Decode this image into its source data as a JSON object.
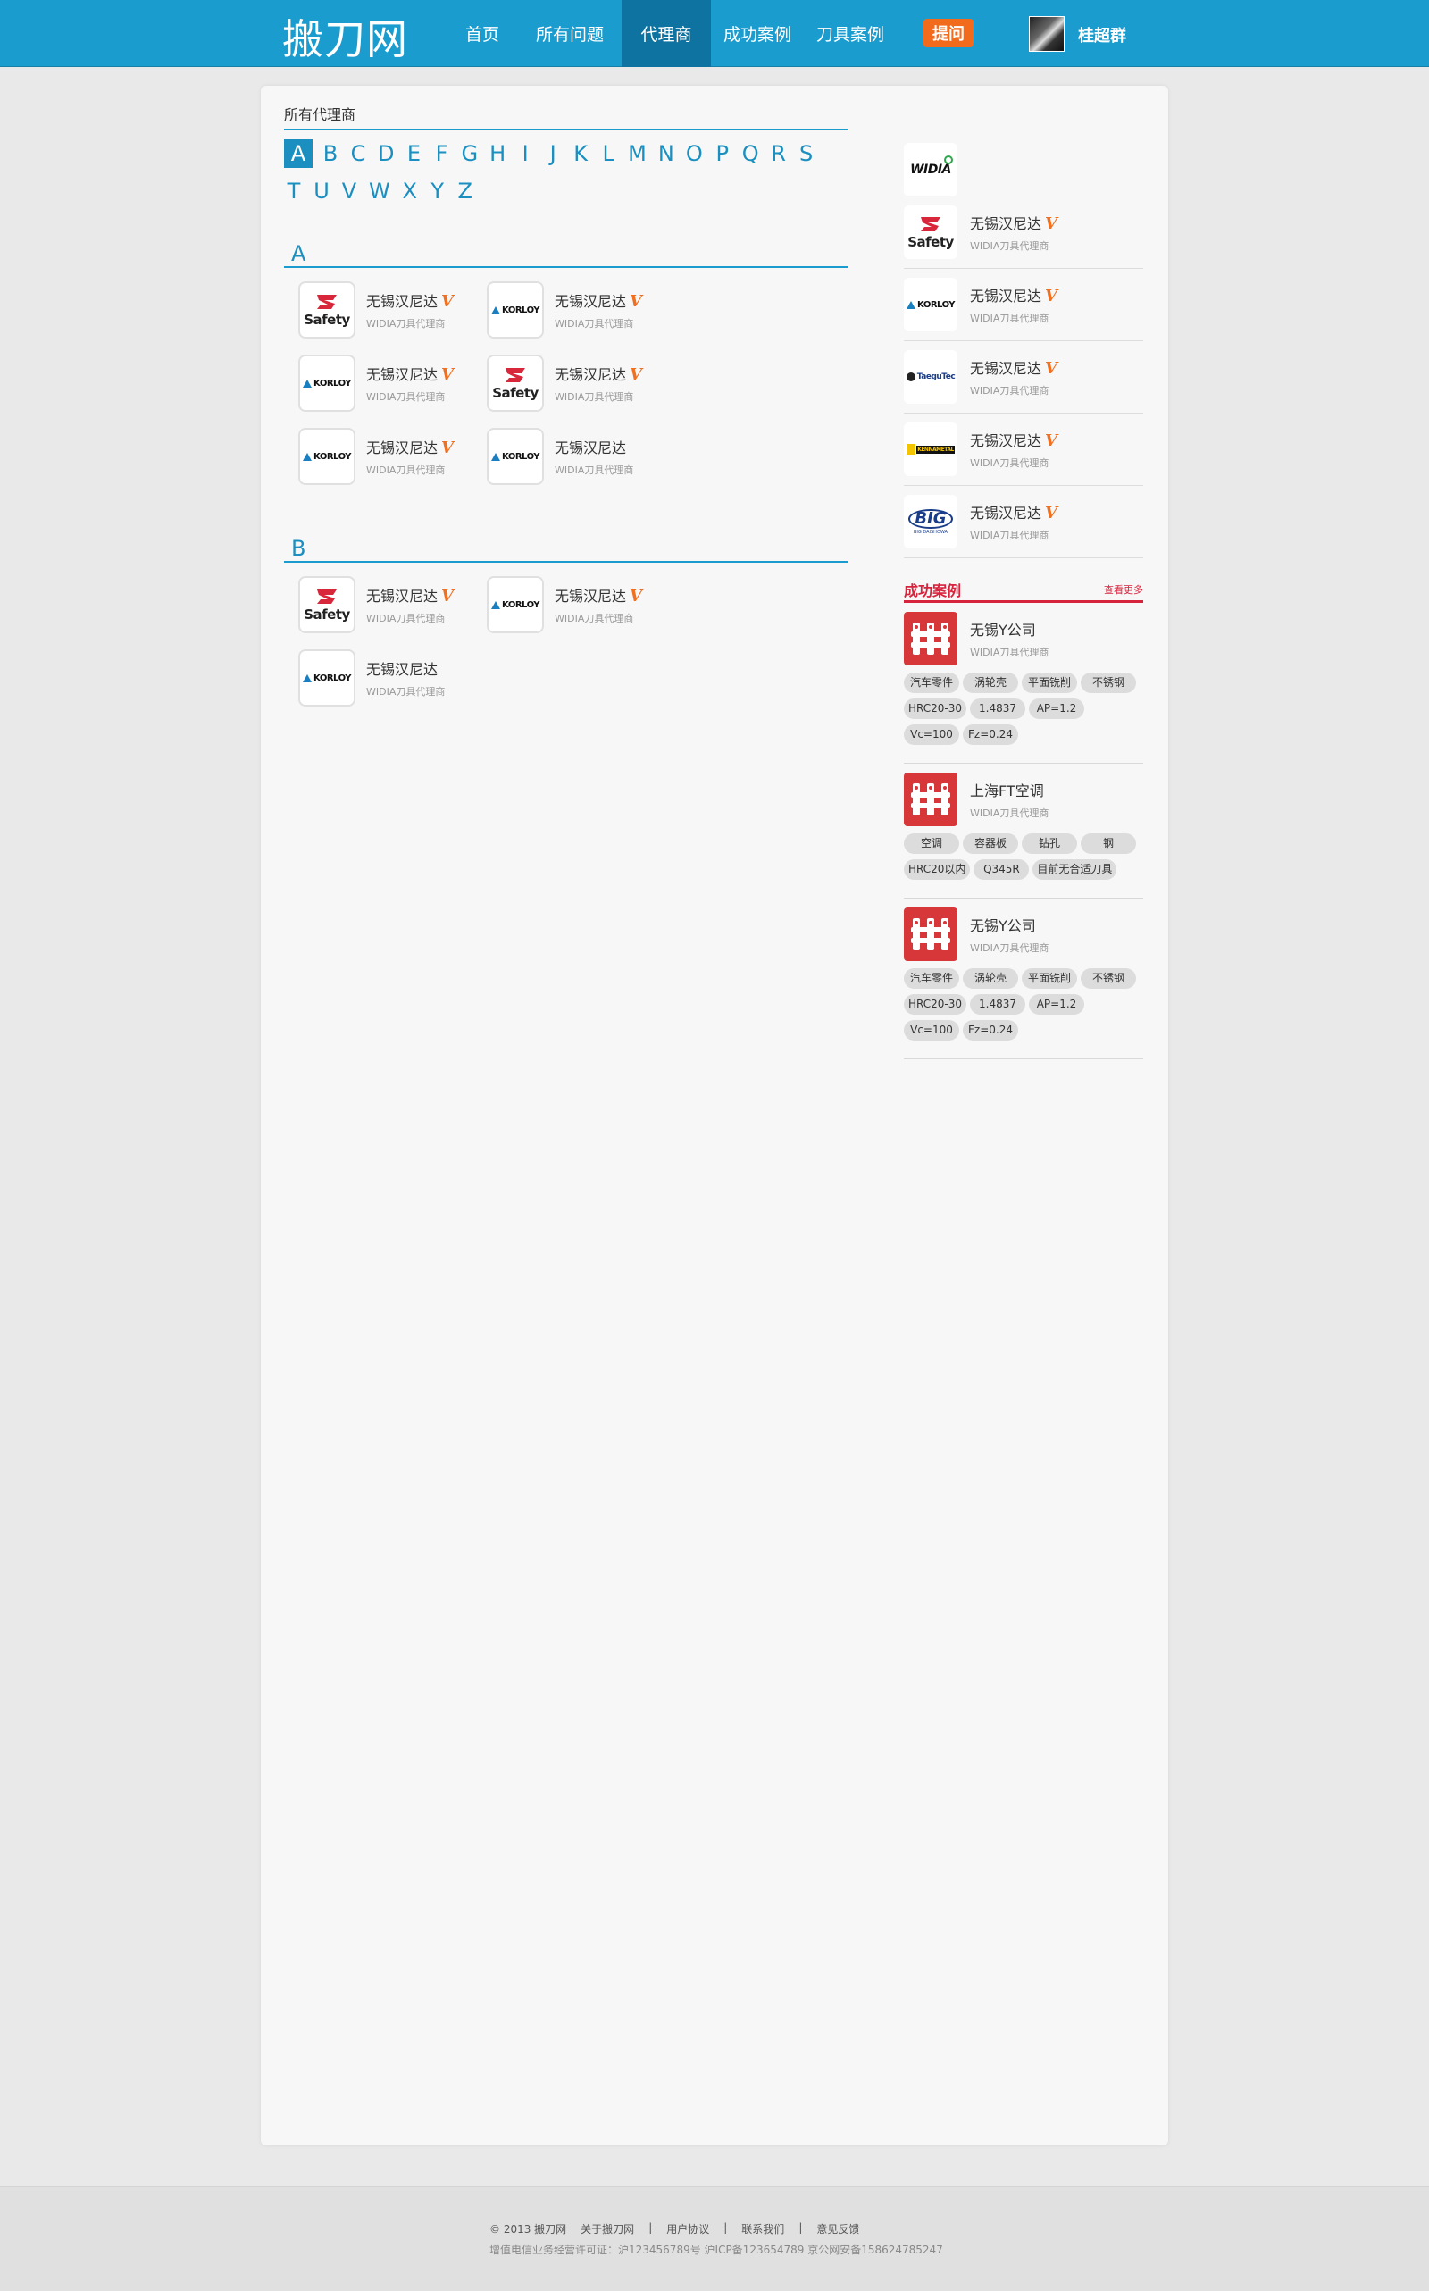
{
  "header": {
    "logo": "搬刀网",
    "nav": [
      {
        "label": "首页",
        "active": false
      },
      {
        "label": "所有问题",
        "active": false
      },
      {
        "label": "代理商",
        "active": true
      },
      {
        "label": "成功案例",
        "active": false
      },
      {
        "label": "刀具案例",
        "active": false
      }
    ],
    "ask_button": "提问",
    "user_name": "桂超群"
  },
  "directory": {
    "title": "所有代理商",
    "letters": [
      "A",
      "B",
      "C",
      "D",
      "E",
      "F",
      "G",
      "H",
      "I",
      "J",
      "K",
      "L",
      "M",
      "N",
      "O",
      "P",
      "Q",
      "R",
      "S",
      "T",
      "U",
      "V",
      "W",
      "X",
      "Y",
      "Z"
    ],
    "active_letter": "A",
    "groups": [
      {
        "letter": "A",
        "agents": [
          {
            "name": "无锡汉尼达",
            "sub": "WIDIA刀具代理商",
            "logo": "safety",
            "verified": true
          },
          {
            "name": "无锡汉尼达",
            "sub": "WIDIA刀具代理商",
            "logo": "korloy",
            "verified": true
          },
          {
            "name": "无锡汉尼达",
            "sub": "WIDIA刀具代理商",
            "logo": "korloy",
            "verified": true
          },
          {
            "name": "无锡汉尼达",
            "sub": "WIDIA刀具代理商",
            "logo": "safety",
            "verified": true
          },
          {
            "name": "无锡汉尼达",
            "sub": "WIDIA刀具代理商",
            "logo": "korloy",
            "verified": true
          },
          {
            "name": "无锡汉尼达",
            "sub": "WIDIA刀具代理商",
            "logo": "korloy",
            "verified": false
          }
        ]
      },
      {
        "letter": "B",
        "agents": [
          {
            "name": "无锡汉尼达",
            "sub": "WIDIA刀具代理商",
            "logo": "safety",
            "verified": true
          },
          {
            "name": "无锡汉尼达",
            "sub": "WIDIA刀具代理商",
            "logo": "korloy",
            "verified": true
          },
          {
            "name": "无锡汉尼达",
            "sub": "WIDIA刀具代理商",
            "logo": "korloy",
            "verified": false
          }
        ]
      }
    ],
    "verified_mark": "V",
    "logo_text": {
      "safety": "Safety",
      "korloy": "KORLOY",
      "taegutec": "TaeguTec",
      "kennametal": "KENNAMETAL",
      "big": "BIG",
      "big_sub": "BIG DAISHOWA",
      "widia": "WIDIA"
    }
  },
  "sidebar": {
    "brand_logo": "WIDIA",
    "agents": [
      {
        "name": "无锡汉尼达",
        "sub": "WIDIA刀具代理商",
        "logo": "safety"
      },
      {
        "name": "无锡汉尼达",
        "sub": "WIDIA刀具代理商",
        "logo": "korloy"
      },
      {
        "name": "无锡汉尼达",
        "sub": "WIDIA刀具代理商",
        "logo": "taegutec"
      },
      {
        "name": "无锡汉尼达",
        "sub": "WIDIA刀具代理商",
        "logo": "kennametal"
      },
      {
        "name": "无锡汉尼达",
        "sub": "WIDIA刀具代理商",
        "logo": "big"
      }
    ],
    "cases_title": "成功案例",
    "cases_more": "查看更多",
    "cases": [
      {
        "name": "无锡Y公司",
        "sub": "WIDIA刀具代理商",
        "tags": [
          "汽车零件",
          "涡轮壳",
          "平面铣削",
          "不锈钢",
          "HRC20-30",
          "1.4837",
          "AP=1.2",
          "Vc=100",
          "Fz=0.24"
        ]
      },
      {
        "name": "上海FT空调",
        "sub": "WIDIA刀具代理商",
        "tags": [
          "空调",
          "容器板",
          "钻孔",
          "钢",
          "HRC20以内",
          "Q345R",
          "目前无合适刀具"
        ]
      },
      {
        "name": "无锡Y公司",
        "sub": "WIDIA刀具代理商",
        "tags": [
          "汽车零件",
          "涡轮壳",
          "平面铣削",
          "不锈钢",
          "HRC20-30",
          "1.4837",
          "AP=1.2",
          "Vc=100",
          "Fz=0.24"
        ]
      }
    ]
  },
  "footer": {
    "copyright": "© 2013 搬刀网",
    "links": [
      "关于搬刀网",
      "|",
      "用户协议",
      "|",
      "联系我们",
      "|",
      "意见反馈"
    ],
    "info": "增值电信业务经营许可证：沪123456789号   沪ICP备123654789   京公网安备158624785247"
  },
  "colors": {
    "brand": "#1a9ccf",
    "accent": "#f26b1d",
    "cases_red": "#d8233d"
  }
}
